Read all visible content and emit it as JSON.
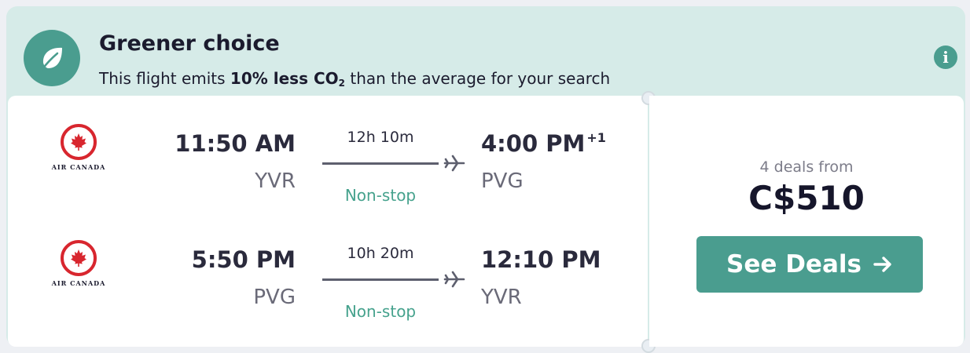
{
  "banner": {
    "icon": "leaf-icon",
    "title": "Greener choice",
    "subtitle_prefix": "This flight emits ",
    "subtitle_highlight": "10% less CO",
    "subtitle_sub": "2",
    "subtitle_suffix": " than the average for your search",
    "info_icon": "info-icon",
    "info_glyph": "i"
  },
  "legs": [
    {
      "airline": "AIR CANADA",
      "depart_time": "11:50 AM",
      "depart_airport": "YVR",
      "duration": "12h 10m",
      "stops": "Non-stop",
      "arrive_time": "4:00 PM",
      "arrive_day_offset": "+1",
      "arrive_airport": "PVG"
    },
    {
      "airline": "AIR CANADA",
      "depart_time": "5:50 PM",
      "depart_airport": "PVG",
      "duration": "10h 20m",
      "stops": "Non-stop",
      "arrive_time": "12:10 PM",
      "arrive_day_offset": "",
      "arrive_airport": "YVR"
    }
  ],
  "pricing": {
    "deals_label": "4 deals from",
    "price": "C$510",
    "button_label": "See Deals",
    "button_icon": "arrow-right-icon"
  },
  "colors": {
    "accent": "#4a9d8f",
    "banner_bg": "#d6ebe8",
    "stops_text": "#46a28d",
    "airline_red": "#d8262e"
  }
}
